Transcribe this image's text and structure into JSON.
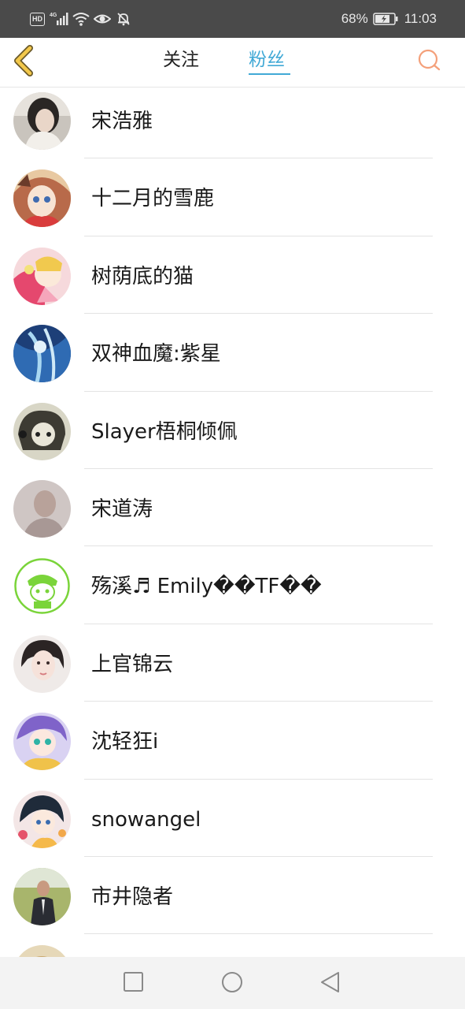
{
  "status_bar": {
    "hd": "HD",
    "network": "4G",
    "battery_percent": "68%",
    "time": "11:03"
  },
  "header": {
    "tabs": [
      {
        "label": "关注",
        "active": false
      },
      {
        "label": "粉丝",
        "active": true
      }
    ],
    "accent_color": "#41a9d6",
    "back_icon_color": "#f3c84b",
    "search_icon_color": "#f4a07a"
  },
  "fans": [
    {
      "name": "宋浩雅",
      "avatar": "photo-portrait"
    },
    {
      "name": "十二月的雪鹿",
      "avatar": "anime-girl"
    },
    {
      "name": "树荫底的猫",
      "avatar": "anime-pink"
    },
    {
      "name": "双神血魔:紫星",
      "avatar": "anime-blue"
    },
    {
      "name": "Slayer梧桐倾佩",
      "avatar": "sketch-drawing"
    },
    {
      "name": "宋道涛",
      "avatar": "photo-man-blurred"
    },
    {
      "name": "殇溪♬ Emily��TF��",
      "avatar": "green-cartoon-badge"
    },
    {
      "name": "上官锦云",
      "avatar": "photo-woman"
    },
    {
      "name": "沈轻狂i",
      "avatar": "anime-purple"
    },
    {
      "name": "snowangel",
      "avatar": "anime-girl-flowers"
    },
    {
      "name": "市井隐者",
      "avatar": "photo-man-field"
    },
    {
      "name": "",
      "avatar": "partial-avatar"
    }
  ],
  "nav_bar": {
    "buttons": [
      "recent-apps",
      "home",
      "back"
    ]
  }
}
